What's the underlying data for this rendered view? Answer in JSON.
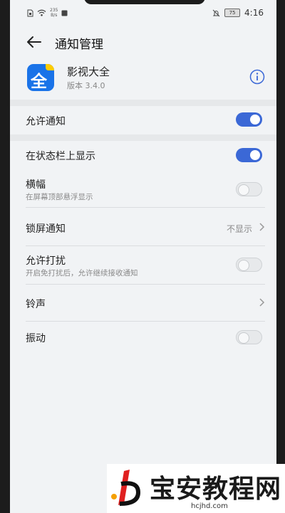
{
  "status_bar": {
    "net_speed_value": "235",
    "net_speed_unit": "B/s",
    "battery": "75",
    "time": "4:16"
  },
  "header": {
    "title": "通知管理"
  },
  "app": {
    "icon_char": "全",
    "name": "影视大全",
    "version": "版本 3.4.0"
  },
  "settings": {
    "allow_notify": {
      "label": "允许通知",
      "on": true
    },
    "status_bar_show": {
      "label": "在状态栏上显示",
      "on": true
    },
    "banner": {
      "label": "横幅",
      "sub": "在屏幕顶部悬浮显示",
      "on": false
    },
    "lockscreen": {
      "label": "锁屏通知",
      "value": "不显示"
    },
    "dnd": {
      "label": "允许打扰",
      "sub": "开启免打扰后，允许继续接收通知",
      "on": false
    },
    "ringtone": {
      "label": "铃声"
    },
    "vibrate": {
      "label": "振动",
      "on": false
    }
  },
  "watermark": {
    "text": "宝安教程网",
    "site": "hcjhd.com"
  },
  "colors": {
    "accent": "#3b68d6",
    "background": "#f1f3f5",
    "app_icon": "#1a73e8"
  }
}
